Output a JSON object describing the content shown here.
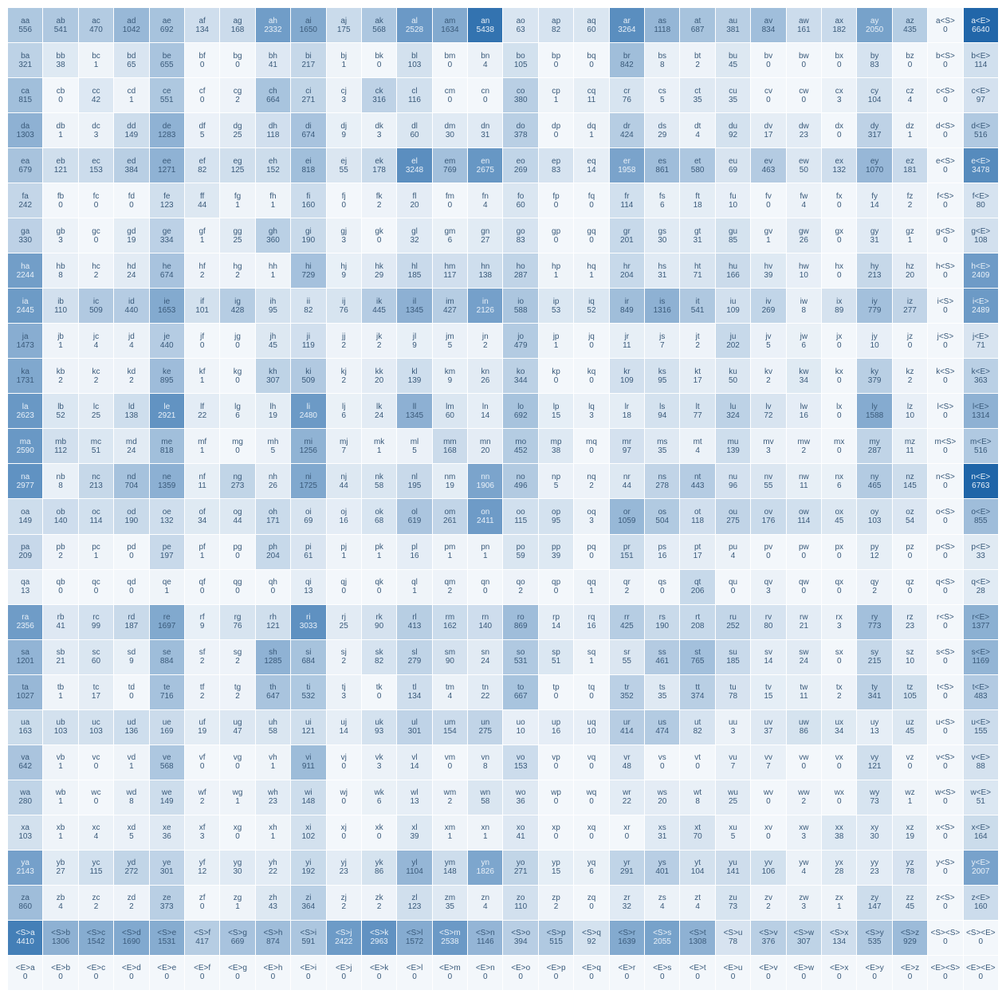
{
  "chart_data": {
    "type": "heatmap",
    "title": "",
    "rows": [
      "a",
      "b",
      "c",
      "d",
      "e",
      "f",
      "g",
      "h",
      "i",
      "j",
      "k",
      "l",
      "m",
      "n",
      "o",
      "p",
      "q",
      "r",
      "s",
      "t",
      "u",
      "v",
      "w",
      "x",
      "y",
      "z",
      "<S>",
      "<E>"
    ],
    "cols": [
      "a",
      "b",
      "c",
      "d",
      "e",
      "f",
      "g",
      "h",
      "i",
      "j",
      "k",
      "l",
      "m",
      "n",
      "o",
      "p",
      "q",
      "r",
      "s",
      "t",
      "u",
      "v",
      "w",
      "x",
      "y",
      "z",
      "<S>",
      "<E>"
    ],
    "color_scale": {
      "low": "#f3f7fb",
      "high": "#1f65a8"
    },
    "values": [
      [
        556,
        541,
        470,
        1042,
        692,
        134,
        168,
        2332,
        1650,
        175,
        568,
        2528,
        1634,
        5438,
        63,
        82,
        60,
        3264,
        1118,
        687,
        381,
        834,
        161,
        182,
        2050,
        435,
        0,
        6640
      ],
      [
        321,
        38,
        1,
        65,
        655,
        0,
        0,
        41,
        217,
        1,
        0,
        103,
        0,
        4,
        105,
        0,
        0,
        842,
        8,
        2,
        45,
        0,
        0,
        0,
        83,
        0,
        0,
        114
      ],
      [
        815,
        0,
        42,
        1,
        551,
        0,
        2,
        664,
        271,
        3,
        316,
        116,
        0,
        0,
        380,
        1,
        11,
        76,
        5,
        35,
        35,
        0,
        0,
        3,
        104,
        4,
        0,
        97
      ],
      [
        1303,
        1,
        3,
        149,
        1283,
        5,
        25,
        118,
        674,
        9,
        3,
        60,
        30,
        31,
        378,
        0,
        1,
        424,
        29,
        4,
        92,
        17,
        23,
        0,
        317,
        1,
        0,
        516
      ],
      [
        679,
        121,
        153,
        384,
        1271,
        82,
        125,
        152,
        818,
        55,
        178,
        3248,
        769,
        2675,
        269,
        83,
        14,
        1958,
        861,
        580,
        69,
        463,
        50,
        132,
        1070,
        181,
        0,
        3478
      ],
      [
        242,
        0,
        0,
        0,
        123,
        44,
        1,
        1,
        160,
        0,
        2,
        20,
        0,
        4,
        60,
        0,
        0,
        114,
        6,
        18,
        10,
        0,
        4,
        0,
        14,
        2,
        0,
        80
      ],
      [
        330,
        3,
        0,
        19,
        334,
        1,
        25,
        360,
        190,
        3,
        0,
        32,
        6,
        27,
        83,
        0,
        0,
        201,
        30,
        31,
        85,
        1,
        26,
        0,
        31,
        1,
        0,
        108
      ],
      [
        2244,
        8,
        2,
        24,
        674,
        2,
        2,
        1,
        729,
        9,
        29,
        185,
        117,
        138,
        287,
        1,
        1,
        204,
        31,
        71,
        166,
        39,
        10,
        0,
        213,
        20,
        0,
        2409
      ],
      [
        2445,
        110,
        509,
        440,
        1653,
        101,
        428,
        95,
        82,
        76,
        445,
        1345,
        427,
        2126,
        588,
        53,
        52,
        849,
        1316,
        541,
        109,
        269,
        8,
        89,
        779,
        277,
        0,
        2489
      ],
      [
        1473,
        1,
        4,
        4,
        440,
        0,
        0,
        45,
        119,
        2,
        2,
        9,
        5,
        2,
        479,
        1,
        0,
        11,
        7,
        2,
        202,
        5,
        6,
        0,
        10,
        0,
        0,
        71
      ],
      [
        1731,
        2,
        2,
        2,
        895,
        1,
        0,
        307,
        509,
        2,
        20,
        139,
        9,
        26,
        344,
        0,
        0,
        109,
        95,
        17,
        50,
        2,
        34,
        0,
        379,
        2,
        0,
        363
      ],
      [
        2623,
        52,
        25,
        138,
        2921,
        22,
        6,
        19,
        2480,
        6,
        24,
        1345,
        60,
        14,
        692,
        15,
        3,
        18,
        94,
        77,
        324,
        72,
        16,
        0,
        1588,
        10,
        0,
        1314
      ],
      [
        2590,
        112,
        51,
        24,
        818,
        1,
        0,
        5,
        1256,
        7,
        1,
        5,
        168,
        20,
        452,
        38,
        0,
        97,
        35,
        4,
        139,
        3,
        2,
        0,
        287,
        11,
        0,
        516
      ],
      [
        2977,
        8,
        213,
        704,
        1359,
        11,
        273,
        26,
        1725,
        44,
        58,
        195,
        19,
        1906,
        496,
        5,
        2,
        44,
        278,
        443,
        96,
        55,
        11,
        6,
        465,
        145,
        0,
        6763
      ],
      [
        149,
        140,
        114,
        190,
        132,
        34,
        44,
        171,
        69,
        16,
        68,
        619,
        261,
        2411,
        115,
        95,
        3,
        1059,
        504,
        118,
        275,
        176,
        114,
        45,
        103,
        54,
        0,
        855
      ],
      [
        209,
        2,
        1,
        0,
        197,
        1,
        0,
        204,
        61,
        1,
        1,
        16,
        1,
        1,
        59,
        39,
        0,
        151,
        16,
        17,
        4,
        0,
        0,
        0,
        12,
        0,
        0,
        33
      ],
      [
        13,
        0,
        0,
        0,
        1,
        0,
        0,
        0,
        13,
        0,
        0,
        1,
        2,
        0,
        2,
        0,
        1,
        2,
        0,
        206,
        0,
        3,
        0,
        0,
        2,
        0,
        0,
        28
      ],
      [
        2356,
        41,
        99,
        187,
        1697,
        9,
        76,
        121,
        3033,
        25,
        90,
        413,
        162,
        140,
        869,
        14,
        16,
        425,
        190,
        208,
        252,
        80,
        21,
        3,
        773,
        23,
        0,
        1377
      ],
      [
        1201,
        21,
        60,
        9,
        884,
        2,
        2,
        1285,
        684,
        2,
        82,
        279,
        90,
        24,
        531,
        51,
        1,
        55,
        461,
        765,
        185,
        14,
        24,
        0,
        215,
        10,
        0,
        1169
      ],
      [
        1027,
        1,
        17,
        0,
        716,
        2,
        2,
        647,
        532,
        3,
        0,
        134,
        4,
        22,
        667,
        0,
        0,
        352,
        35,
        374,
        78,
        15,
        11,
        2,
        341,
        105,
        0,
        483
      ],
      [
        163,
        103,
        103,
        136,
        169,
        19,
        47,
        58,
        121,
        14,
        93,
        301,
        154,
        275,
        10,
        16,
        10,
        414,
        474,
        82,
        3,
        37,
        86,
        34,
        13,
        45,
        0,
        155
      ],
      [
        642,
        1,
        0,
        1,
        568,
        0,
        0,
        1,
        911,
        0,
        3,
        14,
        0,
        8,
        153,
        0,
        0,
        48,
        0,
        0,
        7,
        7,
        0,
        0,
        121,
        0,
        0,
        88
      ],
      [
        280,
        1,
        0,
        8,
        149,
        2,
        1,
        23,
        148,
        0,
        6,
        13,
        2,
        58,
        36,
        0,
        0,
        22,
        20,
        8,
        25,
        0,
        2,
        0,
        73,
        1,
        0,
        51
      ],
      [
        103,
        1,
        4,
        5,
        36,
        3,
        0,
        1,
        102,
        0,
        0,
        39,
        1,
        1,
        41,
        0,
        0,
        0,
        31,
        70,
        5,
        0,
        3,
        38,
        30,
        19,
        0,
        164
      ],
      [
        2143,
        27,
        115,
        272,
        301,
        12,
        30,
        22,
        192,
        23,
        86,
        1104,
        148,
        1826,
        271,
        15,
        6,
        291,
        401,
        104,
        141,
        106,
        4,
        28,
        23,
        78,
        0,
        2007
      ],
      [
        860,
        4,
        2,
        2,
        373,
        0,
        1,
        43,
        364,
        2,
        2,
        123,
        35,
        4,
        110,
        2,
        0,
        32,
        4,
        4,
        73,
        2,
        3,
        1,
        147,
        45,
        0,
        160
      ],
      [
        4410,
        1306,
        1542,
        1690,
        1531,
        417,
        669,
        874,
        591,
        2422,
        2963,
        1572,
        2538,
        1146,
        394,
        515,
        92,
        1639,
        2055,
        1308,
        78,
        376,
        307,
        134,
        535,
        929,
        0,
        0
      ],
      [
        0,
        0,
        0,
        0,
        0,
        0,
        0,
        0,
        0,
        0,
        0,
        0,
        0,
        0,
        0,
        0,
        0,
        0,
        0,
        0,
        0,
        0,
        0,
        0,
        0,
        0,
        0,
        0
      ]
    ]
  }
}
